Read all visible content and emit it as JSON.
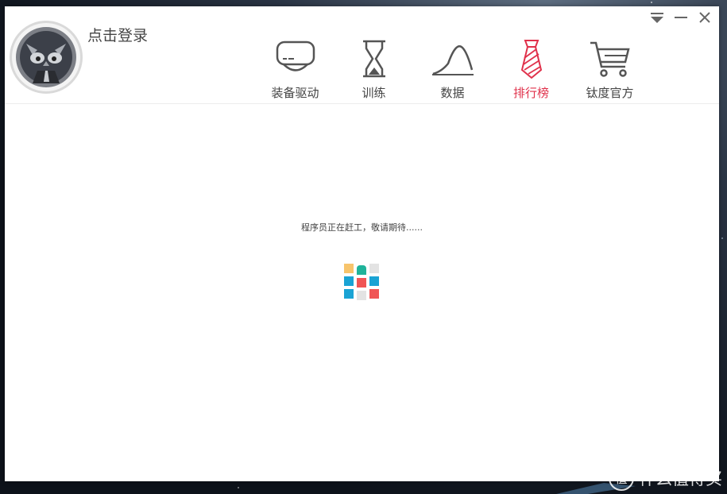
{
  "header": {
    "login_label": "点击登录",
    "nav": [
      {
        "label": "装备驱动",
        "icon": "device-driver-icon",
        "active": false
      },
      {
        "label": "训练",
        "icon": "hourglass-icon",
        "active": false
      },
      {
        "label": "数据",
        "icon": "curve-chart-icon",
        "active": false
      },
      {
        "label": "排行榜",
        "icon": "tie-icon",
        "active": true
      },
      {
        "label": "钛度官方",
        "icon": "shopping-cart-icon",
        "active": false
      }
    ],
    "accent_color": "#e0314b"
  },
  "content": {
    "loading_text": "程序员正在赶工，敬请期待......",
    "loader_colors": {
      "yellow": "#f7c46c",
      "teal": "#1fb39a",
      "gray": "#e3e3e3",
      "blue": "#1aa3d4",
      "red": "#f05555"
    }
  },
  "watermark": {
    "glyph": "值",
    "text": "什么值得买"
  }
}
